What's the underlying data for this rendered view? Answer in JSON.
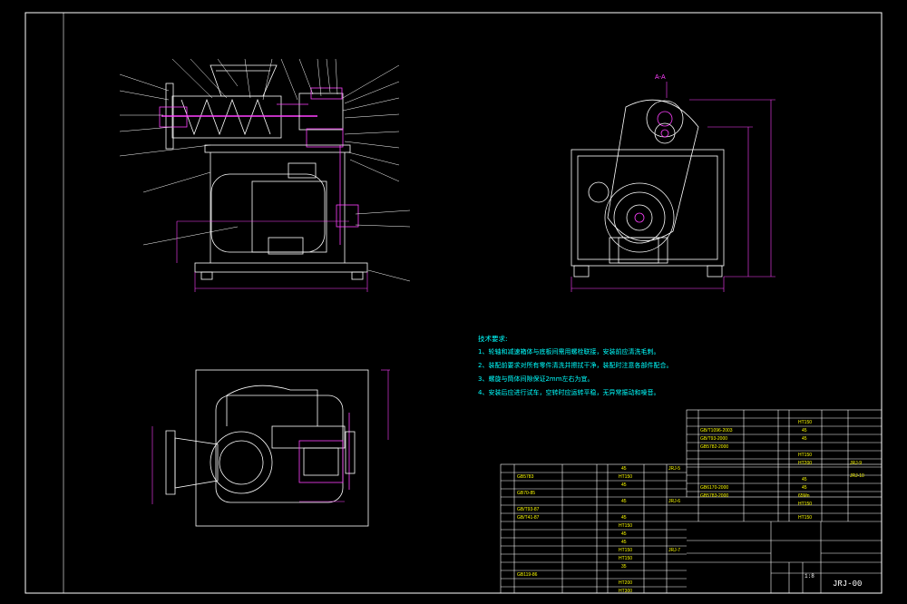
{
  "drawing": {
    "section_label": "A-A",
    "drawing_number": "JRJ-00",
    "scale": "1:8",
    "notes": [
      "技术要求:",
      "1、轮轴和减速箱体与底板间需用螺栓联接，安装前应清洗毛刺。",
      "2、装配前要求对所有零件清洗并擦拭干净，装配时注意各部件配合。",
      "3、螺旋与筒体间隙保证2mm左右为宜。",
      "4、安装后应进行试车，空转时应运转平稳，无异常振动和噪音。"
    ],
    "bom_left_codes": [
      "GB5783",
      "GB70-85",
      "GB/T93-87",
      "GB/T41-87",
      "GB119-86"
    ],
    "bom_left_materials": [
      "45",
      "HT150",
      "45",
      "45",
      "45",
      "HT150",
      "45",
      "45",
      "HT150",
      "HT150",
      "35",
      "HT200",
      "HT300"
    ],
    "bom_right_codes": [
      "GB/T1096-2003",
      "GB/T93-2000",
      "GB5782-2000",
      "GB6170-2000",
      "GB5783-2000"
    ],
    "bom_right_materials": [
      "HT150",
      "45",
      "45",
      "HT150",
      "HT200",
      "45",
      "45",
      "65Mn",
      "HT150",
      "HT150"
    ],
    "part_refs": [
      "JRJ-5",
      "JRJ-6",
      "JRJ-7",
      "JRJ-9",
      "JRJ-10"
    ]
  },
  "colors": {
    "background": "#000000",
    "frame": "#ffffff",
    "outline": "#ffffff",
    "dimension": "#ff40ff",
    "text_cyan": "#00ffff",
    "text_yellow": "#ffff00",
    "hatch": "#ff40ff"
  }
}
